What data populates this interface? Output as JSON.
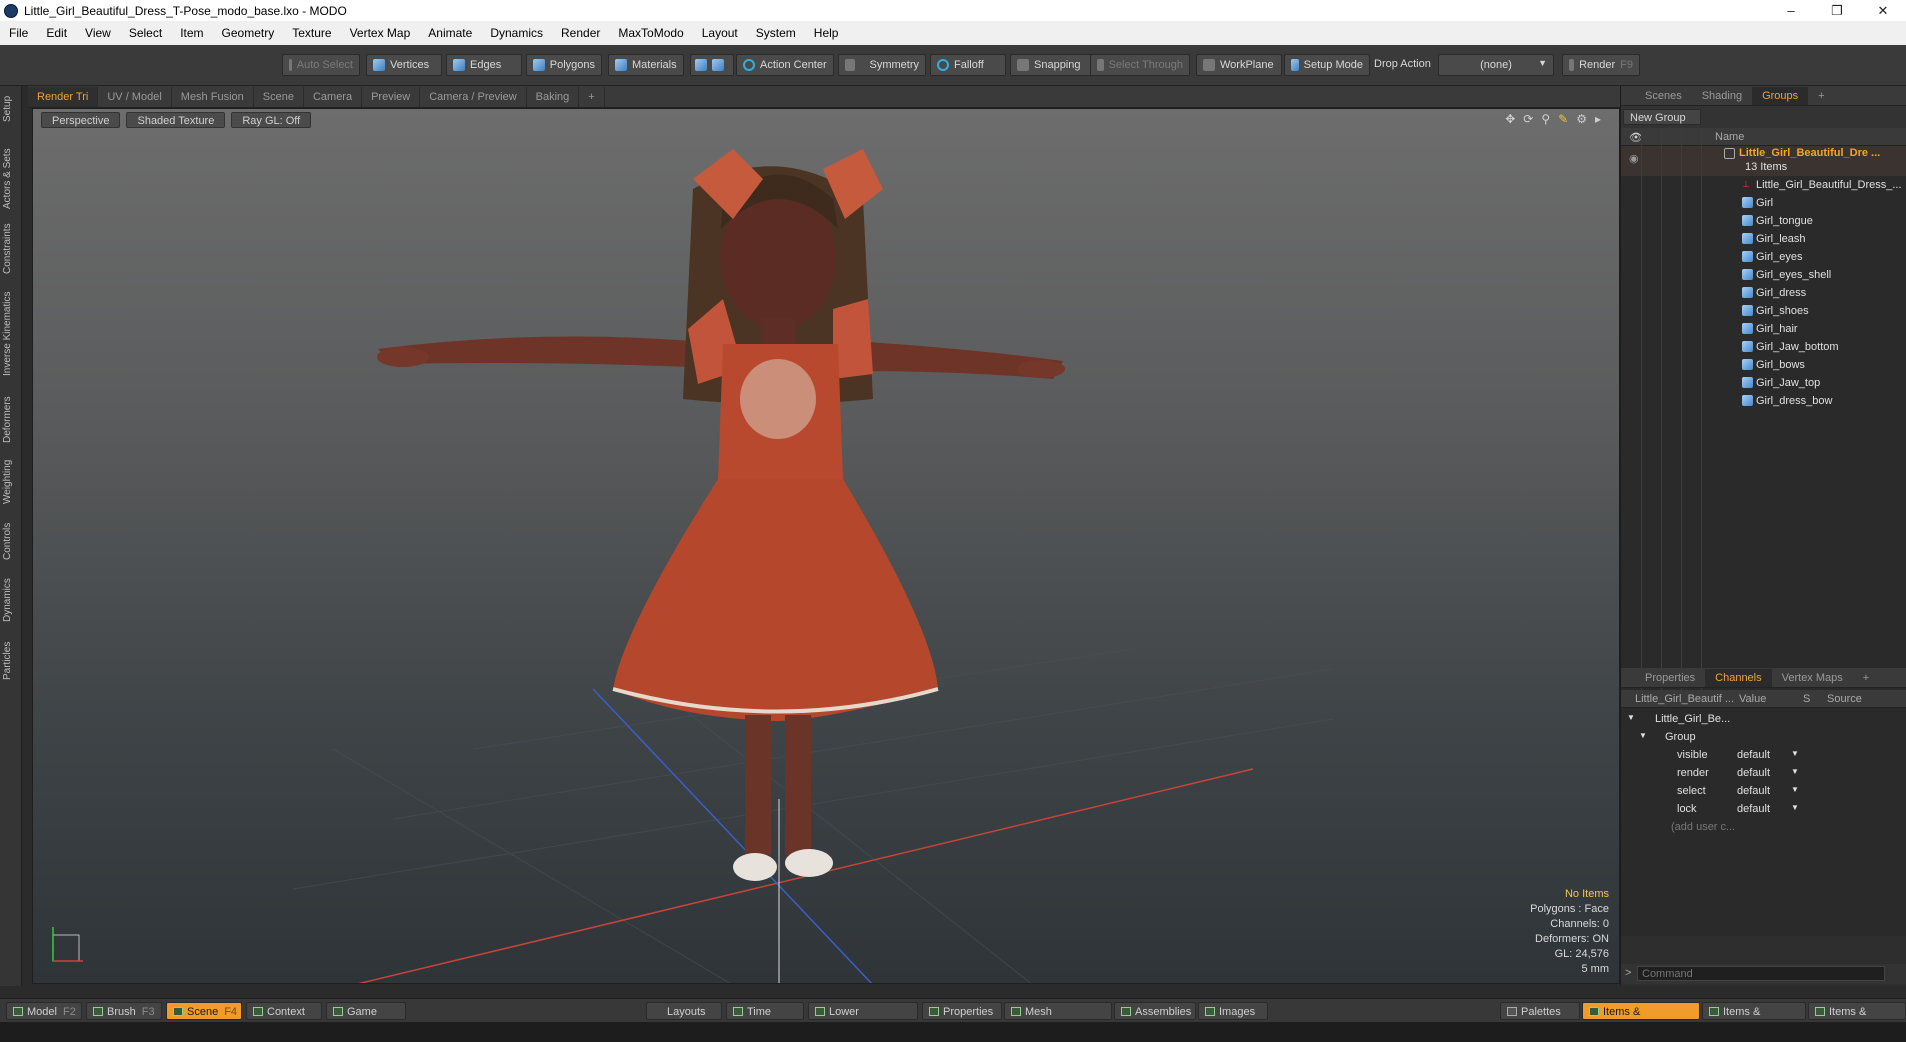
{
  "window": {
    "title": "Little_Girl_Beautiful_Dress_T-Pose_modo_base.lxo - MODO",
    "minimize": "–",
    "restore": "❐",
    "close": "✕"
  },
  "menu": [
    "File",
    "Edit",
    "View",
    "Select",
    "Item",
    "Geometry",
    "Texture",
    "Vertex Map",
    "Animate",
    "Dynamics",
    "Render",
    "MaxToModo",
    "Layout",
    "System",
    "Help"
  ],
  "toolbar": {
    "auto_select": "Auto Select",
    "vertices": "Vertices",
    "edges": "Edges",
    "polygons": "Polygons",
    "materials": "Materials",
    "action_center": "Action Center",
    "symmetry": "Symmetry",
    "falloff": "Falloff",
    "snapping": "Snapping",
    "select_through": "Select Through",
    "workplane": "WorkPlane",
    "setup_mode": "Setup Mode",
    "drop_action": "Drop Action",
    "drop_value": "(none)",
    "render": "Render",
    "render_key": "F9"
  },
  "left_tabs": [
    "Setup",
    "Actors & Sets",
    "Constraints",
    "Inverse Kinematics",
    "Deformers",
    "Weighting",
    "Controls",
    "Dynamics",
    "Particles"
  ],
  "viewport_tabs": [
    "Render Tri",
    "UV / Model",
    "Mesh Fusion",
    "Scene",
    "Camera",
    "Preview",
    "Camera / Preview",
    "Baking",
    "+"
  ],
  "viewport": {
    "perspective": "Perspective",
    "shading": "Shaded Texture",
    "raygl": "Ray GL: Off",
    "info": {
      "items": "No Items",
      "polygons": "Polygons : Face",
      "channels": "Channels: 0",
      "deformers": "Deformers: ON",
      "gl": "GL: 24,576",
      "scale": "5 mm"
    }
  },
  "right_tabs": [
    "Scenes",
    "Shading",
    "Groups",
    "+"
  ],
  "groups": {
    "new_group": "New Group",
    "name_header": "Name",
    "root": "Little_Girl_Beautiful_Dre ...",
    "count": "13 Items",
    "items": [
      "Little_Girl_Beautiful_Dress_...",
      "Girl",
      "Girl_tongue",
      "Girl_leash",
      "Girl_eyes",
      "Girl_eyes_shell",
      "Girl_dress",
      "Girl_shoes",
      "Girl_hair",
      "Girl_Jaw_bottom",
      "Girl_bows",
      "Girl_Jaw_top",
      "Girl_dress_bow"
    ]
  },
  "channel_tabs": [
    "Properties",
    "Channels",
    "Vertex Maps",
    "+"
  ],
  "channels": {
    "col_name": "Little_Girl_Beautif ...",
    "col_value": "Value",
    "col_s": "S",
    "col_source": "Source",
    "item": "Little_Girl_Be...",
    "group": "Group",
    "rows": [
      {
        "name": "visible",
        "value": "default"
      },
      {
        "name": "render",
        "value": "default"
      },
      {
        "name": "select",
        "value": "default"
      },
      {
        "name": "lock",
        "value": "default"
      }
    ],
    "add_user": "(add user c...",
    "command_placeholder": "Command"
  },
  "statusbar": {
    "model": "Model",
    "model_key": "F2",
    "brush": "Brush",
    "brush_key": "F3",
    "scene": "Scene",
    "scene_key": "F4",
    "context": "Context",
    "game_tools": "Game Tools",
    "layouts": "Layouts",
    "time": "Time",
    "lower_viewports": "Lower Viewports",
    "properties": "Properties",
    "mesh_operations": "Mesh Operations",
    "assemblies": "Assemblies",
    "images": "Images",
    "palettes": "Palettes",
    "items_properties": "Items & Properties",
    "items_groups": "Items & Groups",
    "items_shading": "Items & Shading"
  },
  "colors": {
    "accent": "#f0a33a",
    "selected_group": "#f5a623",
    "dress": "#b5452a",
    "skin": "#7a3a2c"
  }
}
